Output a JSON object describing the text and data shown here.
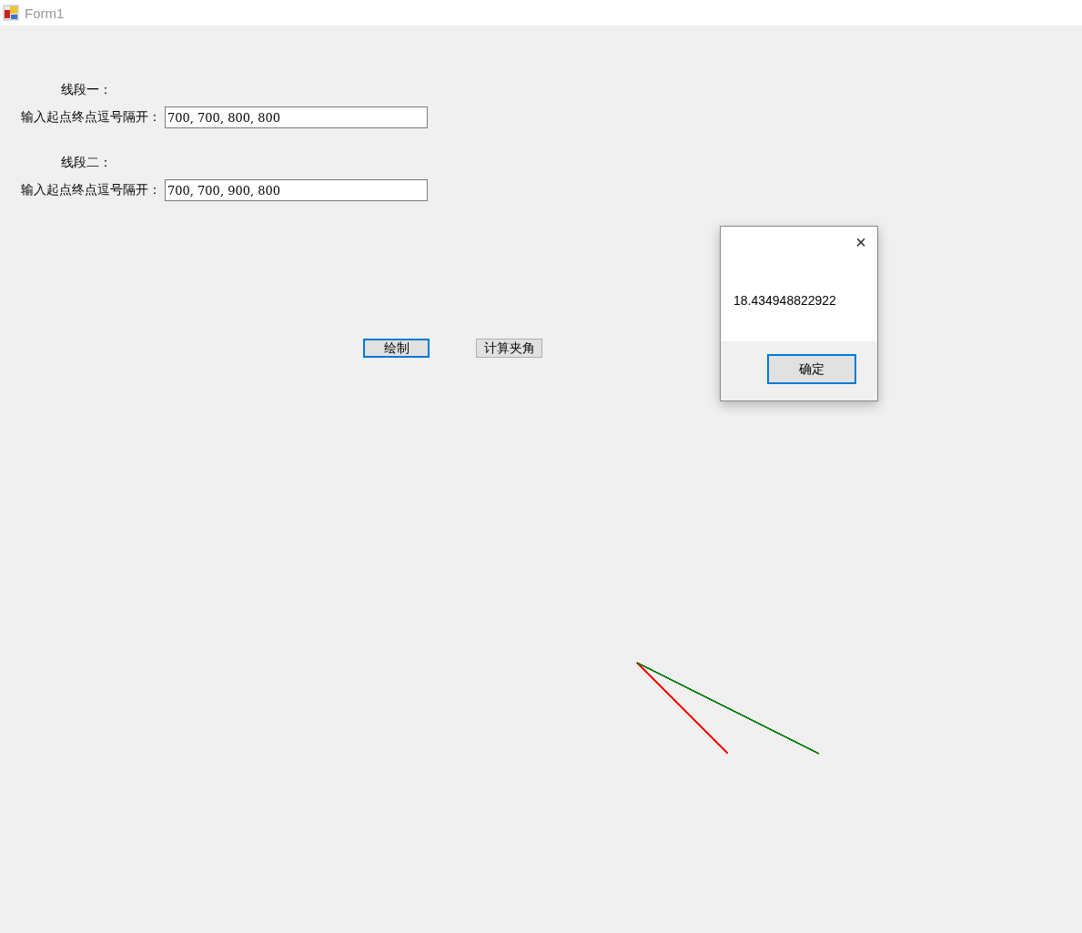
{
  "window": {
    "title": "Form1"
  },
  "segments_form": [
    {
      "heading": "线段一：",
      "label": "输入起点终点逗号隔开：",
      "value": "700, 700, 800, 800"
    },
    {
      "heading": "线段二：",
      "label": "输入起点终点逗号隔开：",
      "value": "700, 700, 900, 800"
    }
  ],
  "buttons": [
    {
      "label": "绘制",
      "focused": true
    },
    {
      "label": "计算夹角",
      "focused": false
    }
  ],
  "segments": [
    {
      "color": "#ff0000"
    },
    {
      "color": "#008000"
    }
  ],
  "dialog": {
    "message": "18.434948822922",
    "close": "×",
    "button": "确定"
  }
}
